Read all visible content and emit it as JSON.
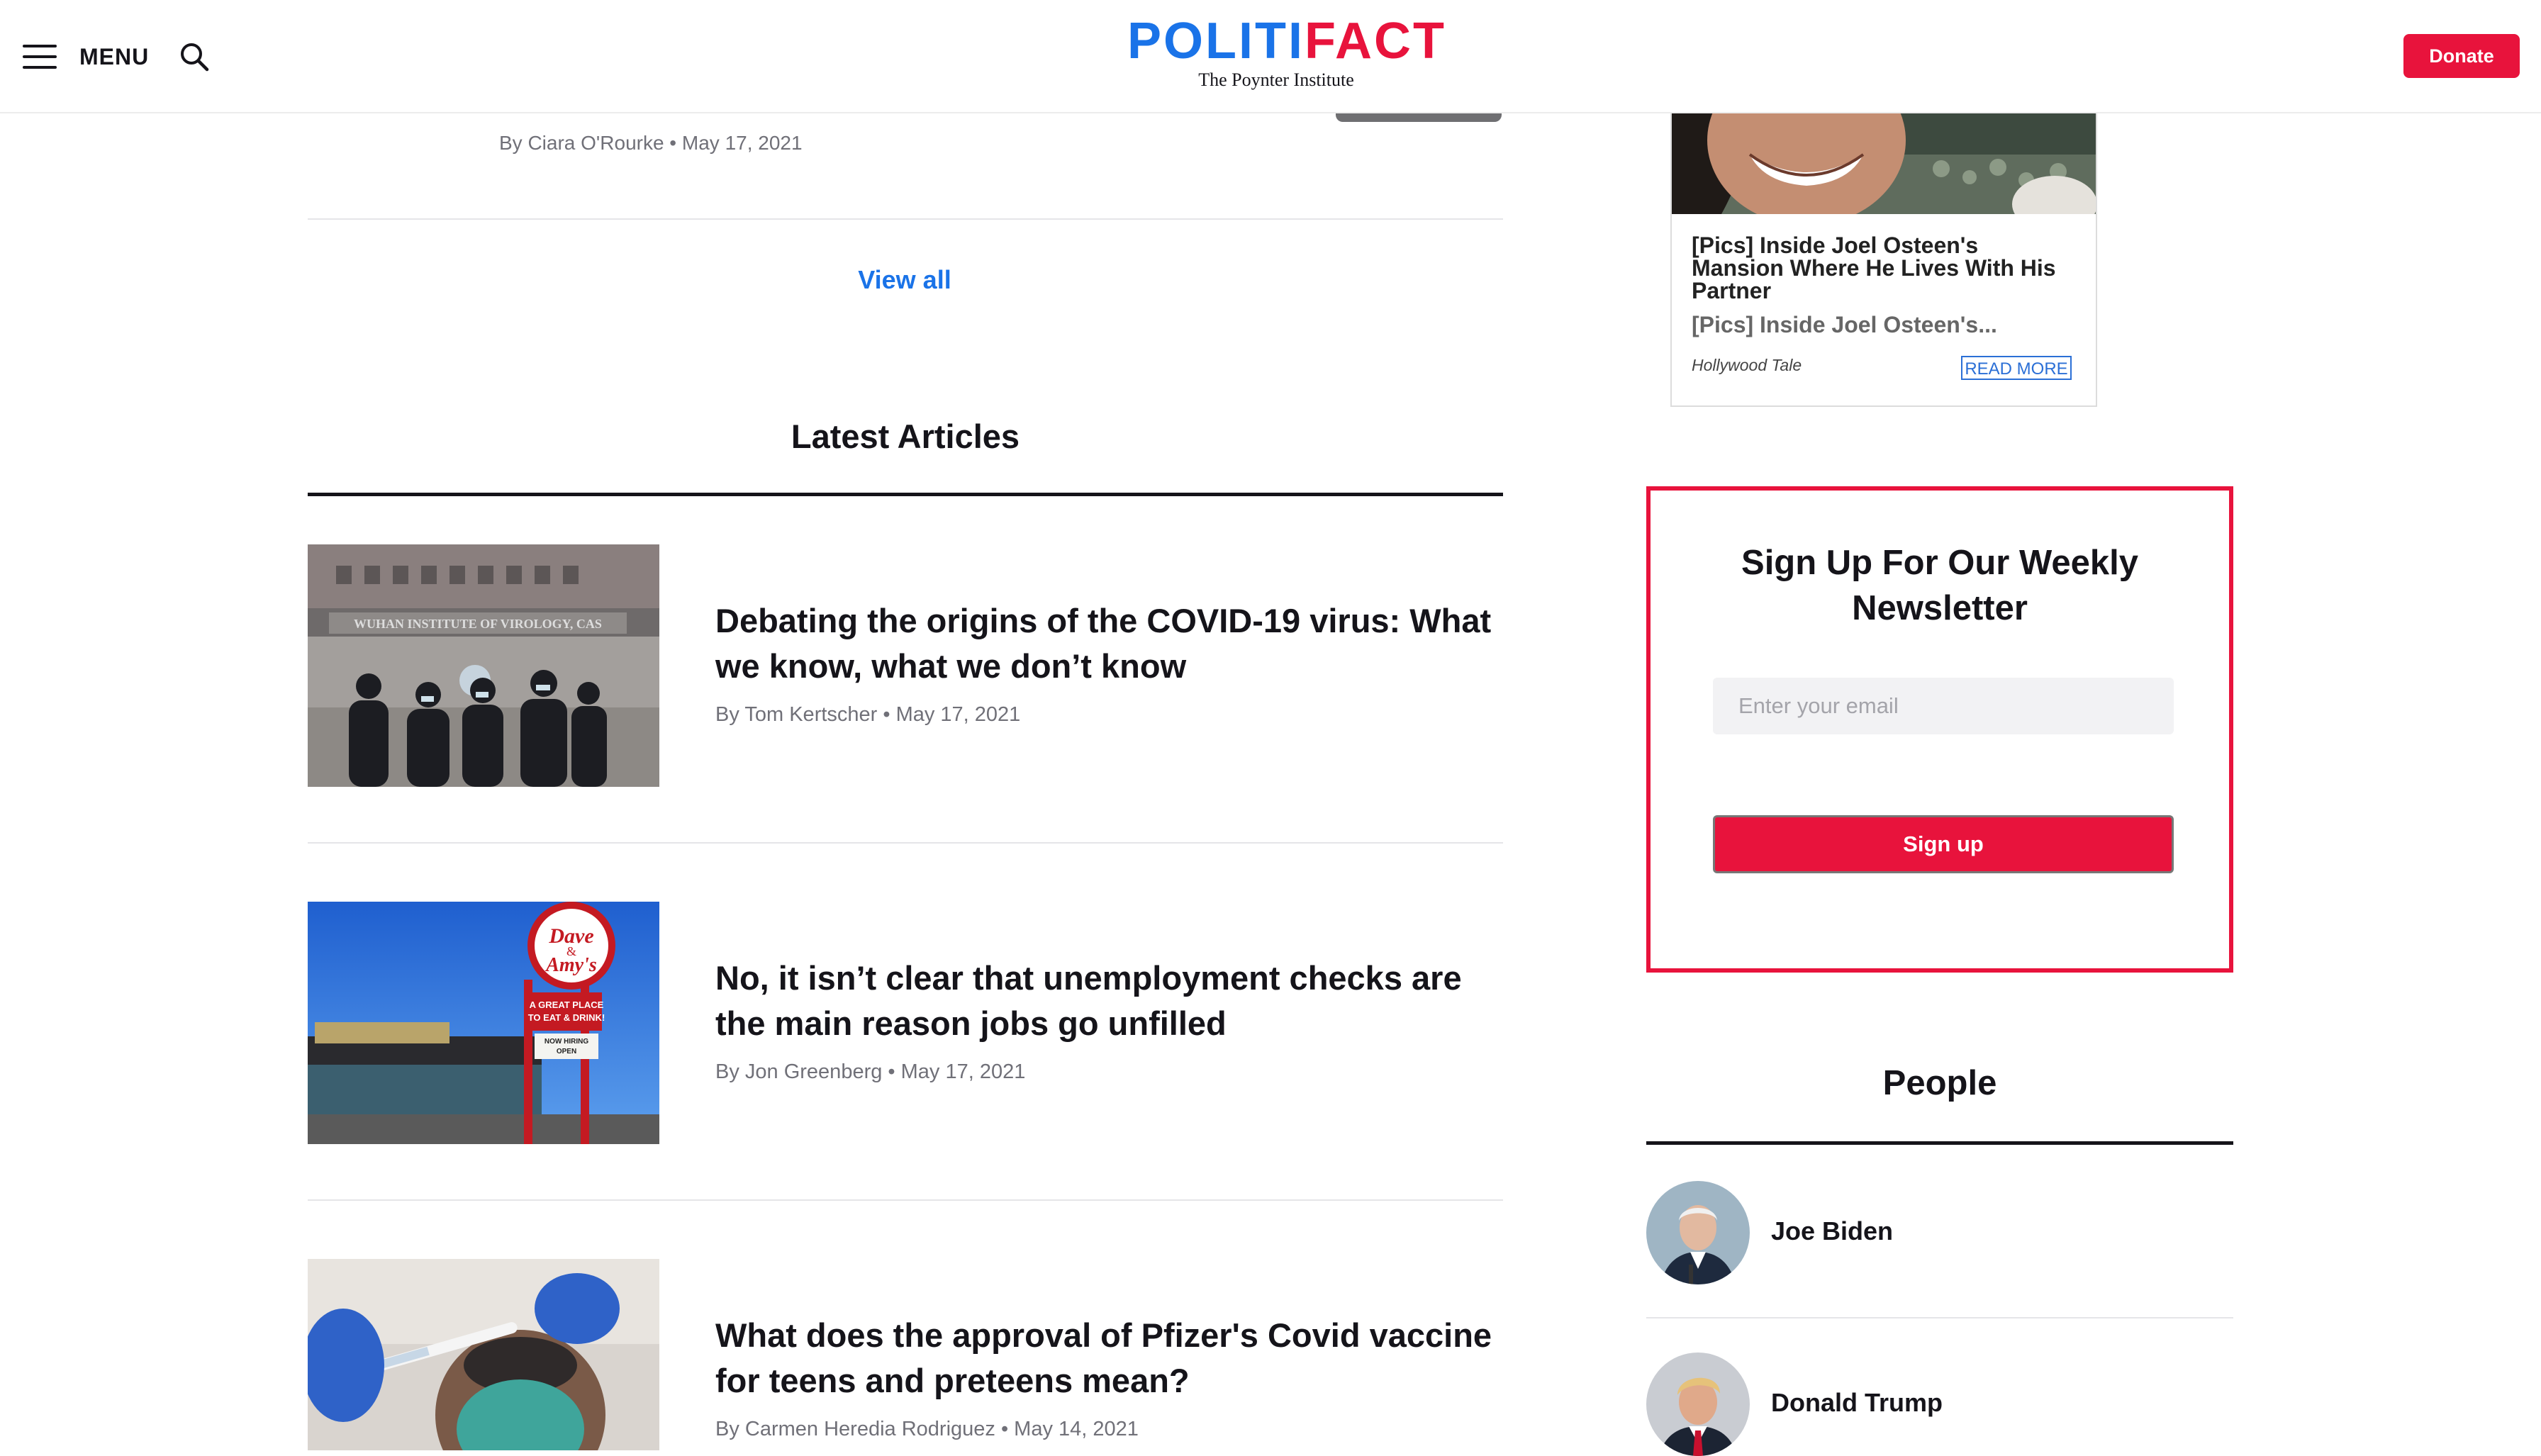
{
  "header": {
    "menu_label": "MENU",
    "logo": {
      "part1": "P",
      "letter_o": "O",
      "part2": "LITI",
      "part3": "FACT",
      "tagline": "The Poynter Institute"
    },
    "donate_label": "Donate"
  },
  "previous_article": {
    "byline": "By Ciara O'Rourke • May 17, 2021"
  },
  "view_all_label": "View all",
  "latest_articles": {
    "title": "Latest Articles",
    "items": [
      {
        "title": "Debating the origins of the COVID-19 virus: What we know, what we don’t know",
        "byline": "By Tom Kertscher • May 17, 2021",
        "image_sign": "WUHAN INSTITUTE OF VIROLOGY, CAS"
      },
      {
        "title": "No, it isn’t clear that unemployment checks are the main reason jobs go unfilled",
        "byline": "By Jon Greenberg • May 17, 2021",
        "image_sign": {
          "line1": "Dave",
          "line2": "&",
          "line3": "Amy's",
          "slogan1": "A GREAT PLACE",
          "slogan2": "TO EAT & DRINK!",
          "hiring1": "NOW HIRING",
          "hiring2": "OPEN"
        }
      },
      {
        "title": "What does the approval of Pfizer's Covid vaccine for teens and preteens mean?",
        "byline": "By Carmen Heredia Rodriguez • May 14, 2021"
      }
    ]
  },
  "ad": {
    "headline": "[Pics] Inside Joel Osteen's Mansion Where He Lives With His Partner",
    "description": "[Pics] Inside Joel Osteen's...",
    "source": "Hollywood Tale",
    "cta": "READ MORE"
  },
  "newsletter": {
    "title": "Sign Up For Our Weekly Newsletter",
    "email_placeholder": "Enter your email",
    "email_value": "",
    "button_label": "Sign up"
  },
  "people": {
    "title": "People",
    "items": [
      {
        "name": "Joe Biden"
      },
      {
        "name": "Donald Trump"
      }
    ]
  },
  "colors": {
    "brand_red": "#e8133c",
    "brand_blue": "#1a73e8",
    "text": "#15141a",
    "muted": "#707078"
  },
  "icons": [
    "hamburger-icon",
    "search-icon"
  ]
}
